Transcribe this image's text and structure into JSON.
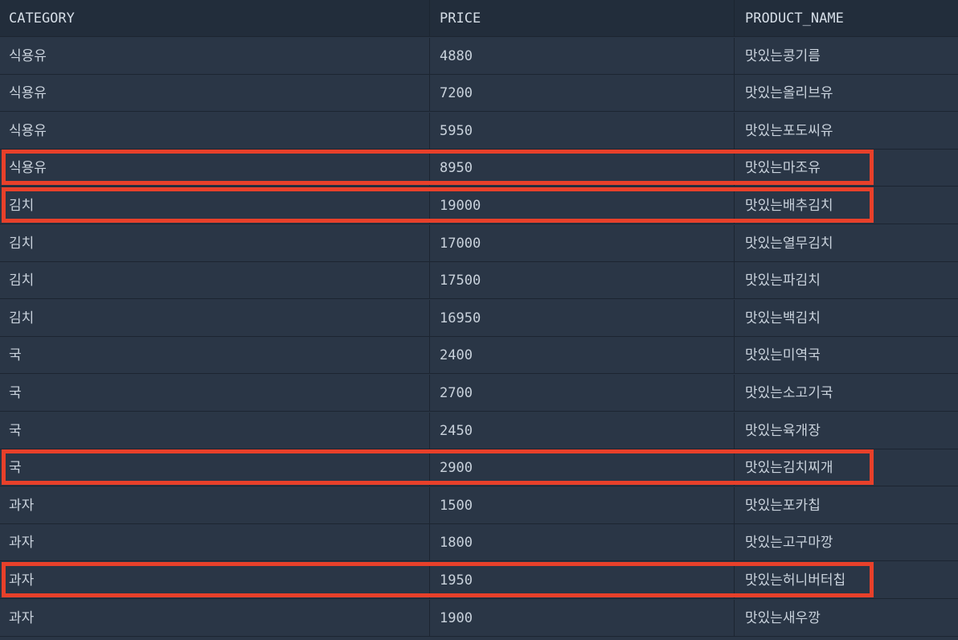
{
  "headers": [
    "CATEGORY",
    "PRICE",
    "PRODUCT_NAME"
  ],
  "rows": [
    {
      "category": "식용유",
      "price": "4880",
      "product_name": "맛있는콩기름",
      "highlighted": false
    },
    {
      "category": "식용유",
      "price": "7200",
      "product_name": "맛있는올리브유",
      "highlighted": false
    },
    {
      "category": "식용유",
      "price": "5950",
      "product_name": "맛있는포도씨유",
      "highlighted": false
    },
    {
      "category": "식용유",
      "price": "8950",
      "product_name": "맛있는마조유",
      "highlighted": true
    },
    {
      "category": "김치",
      "price": "19000",
      "product_name": "맛있는배추김치",
      "highlighted": true
    },
    {
      "category": "김치",
      "price": "17000",
      "product_name": "맛있는열무김치",
      "highlighted": false
    },
    {
      "category": "김치",
      "price": "17500",
      "product_name": "맛있는파김치",
      "highlighted": false
    },
    {
      "category": "김치",
      "price": "16950",
      "product_name": "맛있는백김치",
      "highlighted": false
    },
    {
      "category": "국",
      "price": "2400",
      "product_name": "맛있는미역국",
      "highlighted": false
    },
    {
      "category": "국",
      "price": "2700",
      "product_name": "맛있는소고기국",
      "highlighted": false
    },
    {
      "category": "국",
      "price": "2450",
      "product_name": "맛있는육개장",
      "highlighted": false
    },
    {
      "category": "국",
      "price": "2900",
      "product_name": "맛있는김치찌개",
      "highlighted": true
    },
    {
      "category": "과자",
      "price": "1500",
      "product_name": "맛있는포카칩",
      "highlighted": false
    },
    {
      "category": "과자",
      "price": "1800",
      "product_name": "맛있는고구마깡",
      "highlighted": false
    },
    {
      "category": "과자",
      "price": "1950",
      "product_name": "맛있는허니버터칩",
      "highlighted": true
    },
    {
      "category": "과자",
      "price": "1900",
      "product_name": "맛있는새우깡",
      "highlighted": false
    }
  ],
  "colors": {
    "background": "#2a3646",
    "header_background": "#222d3b",
    "grid_line": "#1c2531",
    "text": "#c9d2dc",
    "highlight_border": "#e8402a"
  }
}
